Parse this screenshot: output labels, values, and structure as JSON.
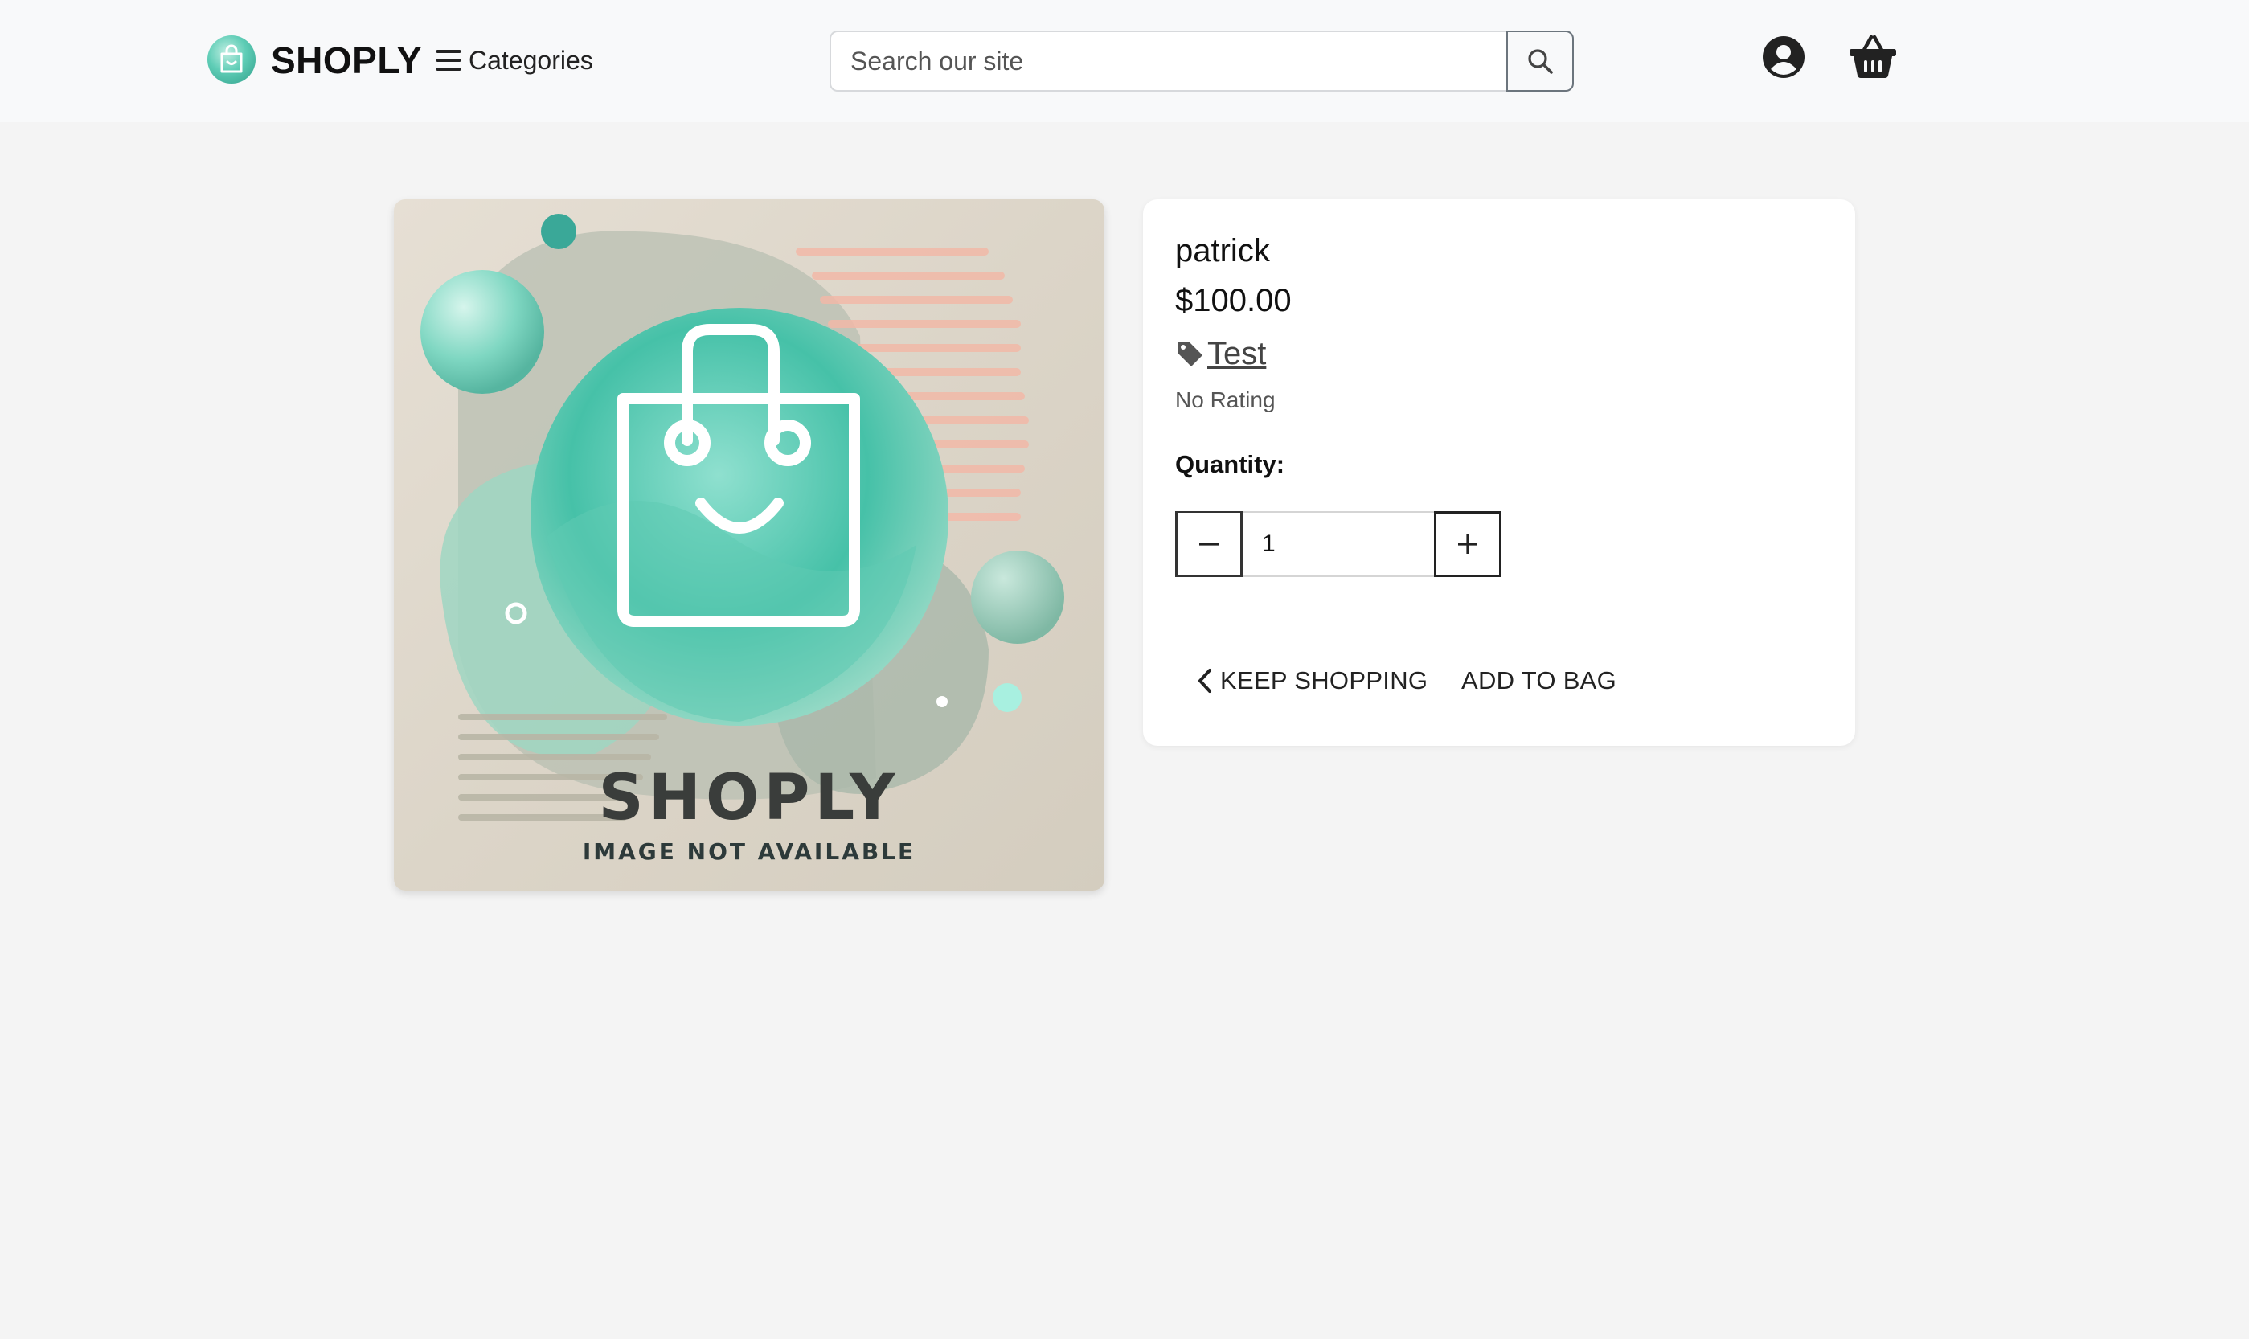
{
  "header": {
    "brand": "SHOPLY",
    "categories_label": "Categories",
    "search_placeholder": "Search our site",
    "search_value": ""
  },
  "product": {
    "image_brand_text": "SHOPLY",
    "image_caption": "IMAGE NOT AVAILABLE",
    "name": "patrick",
    "price": "$100.00",
    "tag": "Test",
    "rating": "No Rating",
    "quantity_label": "Quantity:",
    "quantity_value": "1",
    "keep_shopping_label": "KEEP SHOPPING",
    "add_to_bag_label": "ADD TO BAG"
  },
  "icons": {
    "logo": "shopping-bag-smile-icon",
    "menu": "hamburger-icon",
    "search": "search-icon",
    "account": "user-circle-icon",
    "basket": "basket-icon",
    "tag": "tag-icon",
    "minus": "minus-icon",
    "plus": "plus-icon",
    "back": "chevron-left-icon"
  },
  "colors": {
    "accent_teal": "#5fcdb6",
    "page_bg": "#f4f4f4",
    "header_bg": "#f8f9fa"
  }
}
